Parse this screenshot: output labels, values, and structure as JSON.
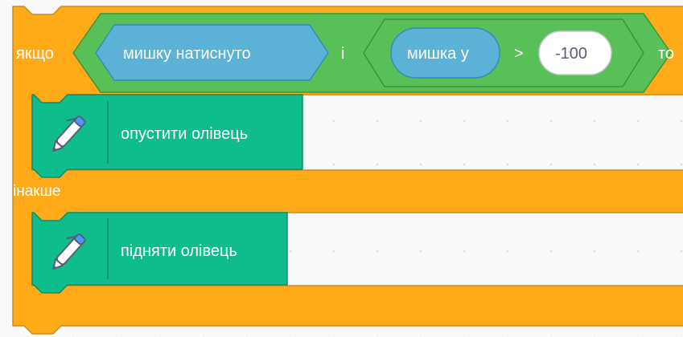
{
  "colors": {
    "control": "#ffab19",
    "control_edge": "#cf8b17",
    "operator": "#59c059",
    "operator_edge": "#389438",
    "sensing": "#5cb1d6",
    "sensing_edge": "#2e8eb8",
    "pen": "#0fbd8c",
    "pen_edge": "#0b8e69",
    "text": "#ffffff",
    "text_dark": "#575e75"
  },
  "if_else_block": {
    "if_label": "якщо",
    "then_label": "то",
    "else_label": "інакше",
    "condition": {
      "and_operator": {
        "left": {
          "label": "мишку натиснуто",
          "icon": "none"
        },
        "operator_label": "і",
        "right": {
          "comparison_operator": ">",
          "left_reporter": "мишка у",
          "right_value": "-100"
        }
      }
    },
    "then_branch": {
      "block_label": "опустити олівець",
      "icon": "pen-icon"
    },
    "else_branch": {
      "block_label": "підняти олівець",
      "icon": "pen-icon"
    }
  }
}
